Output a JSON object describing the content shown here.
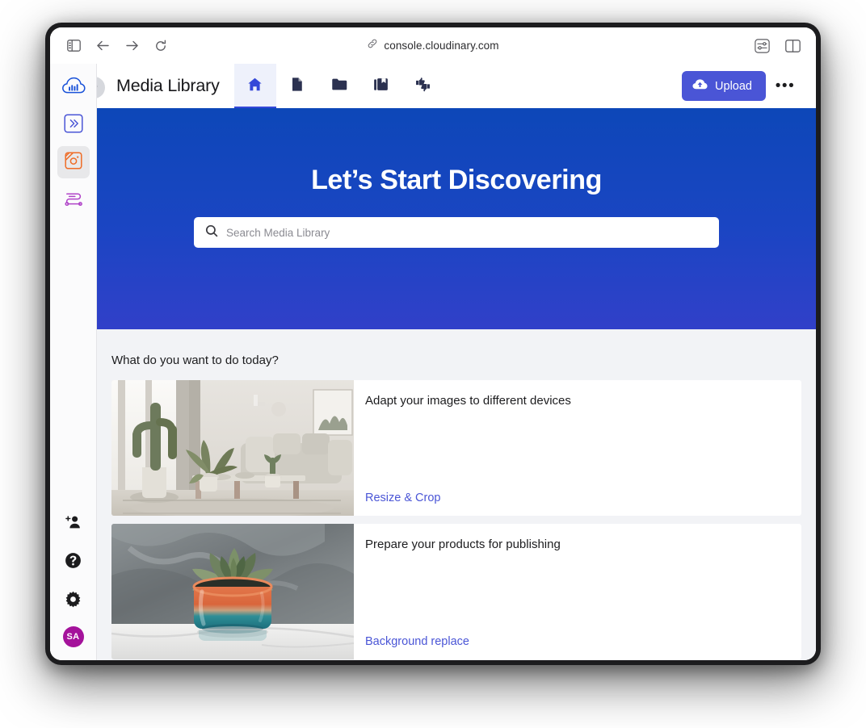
{
  "browser": {
    "url": "console.cloudinary.com",
    "icons": {
      "sidebar_toggle": "sidebar-toggle-icon",
      "back": "back-arrow-icon",
      "forward": "forward-arrow-icon",
      "reload": "reload-icon",
      "link": "link-icon",
      "page_settings": "page-settings-icon",
      "tab_overview": "tab-overview-icon"
    }
  },
  "rail": {
    "items": [
      {
        "name": "cloudinary-logo",
        "icon": "cloud-logo-icon",
        "active": false
      },
      {
        "name": "programmable-media",
        "icon": "code-chevrons-icon",
        "active": false
      },
      {
        "name": "media-library",
        "icon": "media-library-icon",
        "active": true
      },
      {
        "name": "transformations",
        "icon": "transformation-icon",
        "active": false
      }
    ],
    "bottom_items": [
      {
        "name": "invite-user",
        "icon": "add-user-icon"
      },
      {
        "name": "help",
        "icon": "question-mark-icon"
      },
      {
        "name": "settings",
        "icon": "gear-icon"
      }
    ],
    "avatar_initials": "SA"
  },
  "header": {
    "title": "Media Library",
    "collapse_icon": "chevron-right-icon",
    "tabs": [
      {
        "name": "tab-home",
        "icon": "home-icon",
        "active": true
      },
      {
        "name": "tab-assets",
        "icon": "file-icon",
        "active": false
      },
      {
        "name": "tab-folders",
        "icon": "folder-icon",
        "active": false
      },
      {
        "name": "tab-collections",
        "icon": "collections-icon",
        "active": false
      },
      {
        "name": "tab-moderation",
        "icon": "moderation-icon",
        "active": false
      }
    ],
    "upload_label": "Upload",
    "upload_icon": "cloud-upload-icon",
    "more_label": "•••"
  },
  "hero": {
    "title": "Let’s Start Discovering",
    "search_placeholder": "Search Media Library",
    "search_value": "",
    "search_icon": "search-icon"
  },
  "section": {
    "heading": "What do you want to do today?",
    "cards": [
      {
        "title": "Adapt your images to different devices",
        "link": "Resize & Crop",
        "thumb": "living-room-with-cactus-photo"
      },
      {
        "title": "Prepare your products for publishing",
        "link": "Background replace",
        "thumb": "succulent-in-ceramic-pot-photo"
      }
    ]
  },
  "colors": {
    "brand_blue": "#4a55d6",
    "hero_top": "#0d47b8",
    "hero_bottom": "#3140c9",
    "tab_active": "#3448d8",
    "avatar": "#a4129b",
    "media_library_accent": "#ef6c26"
  }
}
